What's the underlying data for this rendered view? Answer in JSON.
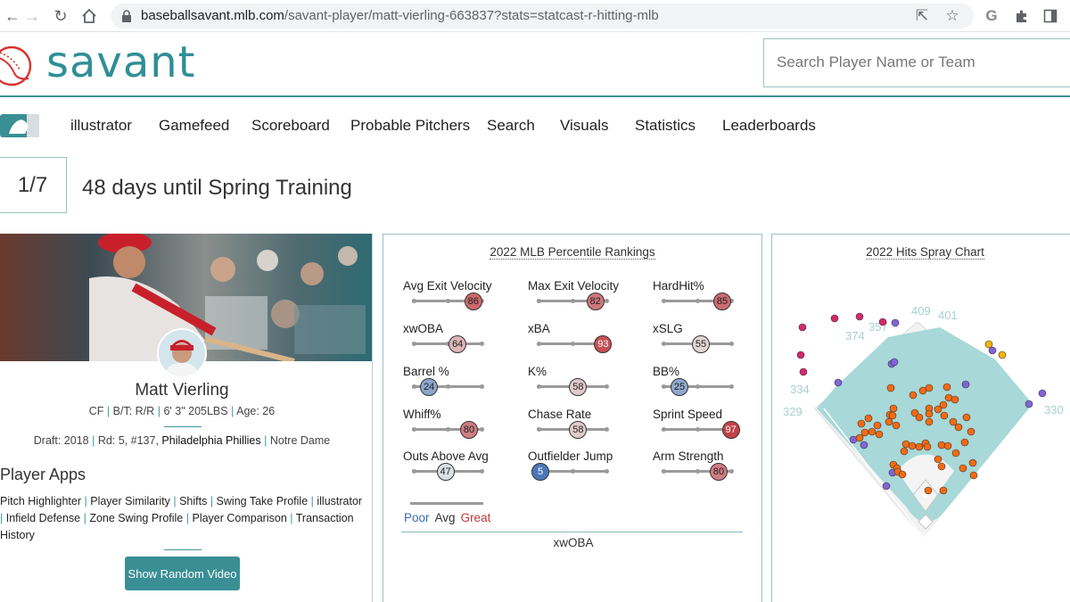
{
  "browser": {
    "url_host": "baseballsavant.mlb.com",
    "url_path": "/savant-player/matt-vierling-663837?stats=statcast-r-hitting-mlb"
  },
  "header": {
    "logo_text": "savant",
    "search_placeholder": "Search Player Name or Team"
  },
  "nav": {
    "items": [
      "illustrator",
      "Gamefeed",
      "Scoreboard",
      "Probable Pitchers",
      "Search",
      "Visuals",
      "Statistics",
      "Leaderboards"
    ]
  },
  "spring": {
    "date": "1/7",
    "countdown": "48 days until Spring Training"
  },
  "player": {
    "name": "Matt Vierling",
    "position": "CF",
    "bats_throws": "B/T: R/R",
    "height_weight": "6' 3\" 205LBS",
    "age": "Age: 26",
    "draft": "Draft: 2018",
    "round_pick": "Rd: 5, #137,",
    "draft_team": "Philadelphia Phillies",
    "college": "Notre Dame"
  },
  "apps": {
    "title": "Player Apps",
    "links": [
      "Pitch Highlighter",
      "Player Similarity",
      "Shifts",
      "Swing Take Profile",
      "illustrator",
      "Infield Defense",
      "Zone Swing Profile",
      "Player Comparison",
      "Transaction History"
    ],
    "button": "Show Random Video"
  },
  "percentiles": {
    "title": "2022 MLB Percentile Rankings",
    "metrics": [
      {
        "label": "Avg Exit Velocity",
        "value": 86
      },
      {
        "label": "Max Exit Velocity",
        "value": 82
      },
      {
        "label": "HardHit%",
        "value": 85
      },
      {
        "label": "xwOBA",
        "value": 64
      },
      {
        "label": "xBA",
        "value": 93
      },
      {
        "label": "xSLG",
        "value": 55
      },
      {
        "label": "Barrel %",
        "value": 24
      },
      {
        "label": "K%",
        "value": 58
      },
      {
        "label": "BB%",
        "value": 25
      },
      {
        "label": "Whiff%",
        "value": 80
      },
      {
        "label": "Chase Rate",
        "value": 58
      },
      {
        "label": "Sprint Speed",
        "value": 97
      },
      {
        "label": "Outs Above Avg",
        "value": 47
      },
      {
        "label": "Outfielder Jump",
        "value": 5
      },
      {
        "label": "Arm Strength",
        "value": 80
      }
    ],
    "legend": {
      "poor": "Poor",
      "avg": "Avg",
      "great": "Great"
    },
    "footer": "xwOBA",
    "colors": {
      "poor": "#3a6bb5",
      "great": "#c0373d"
    }
  },
  "spray": {
    "title": "2022 Hits Spray Chart",
    "distances": [
      "409",
      "401",
      "374",
      "357",
      "334",
      "329",
      "330"
    ],
    "colors": {
      "field": "#a8d8d8",
      "single": "#f56a12",
      "double": "#8264d8",
      "triple": "#f5b400",
      "home_run": "#d6286e"
    }
  }
}
